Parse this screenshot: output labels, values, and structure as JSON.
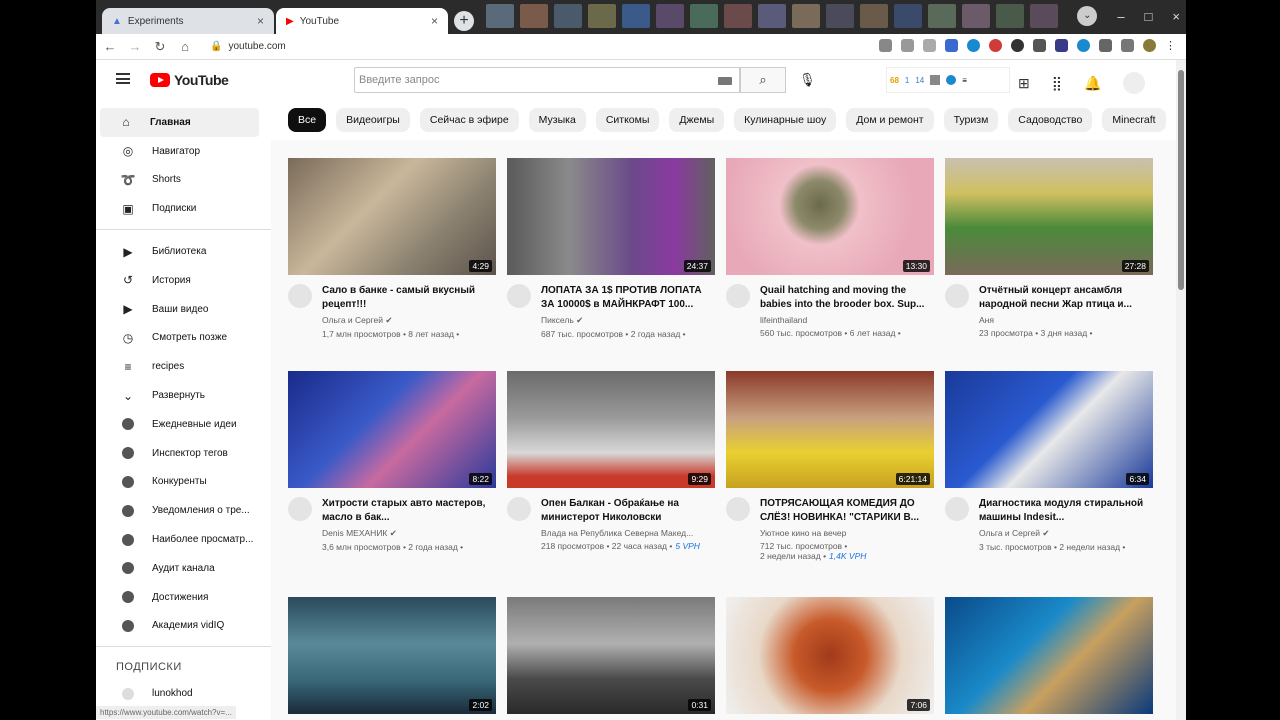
{
  "browser": {
    "tabs": [
      {
        "title": "Experiments",
        "icon_color": "#4a6dd8"
      },
      {
        "title": "YouTube",
        "icon_color": "#ff0000"
      }
    ],
    "url": "youtube.com",
    "status_url": "https://www.youtube.com/watch?v=..."
  },
  "youtube": {
    "logo": "YouTube",
    "search_placeholder": "Введите запрос",
    "vidiq": {
      "v1": "68",
      "v2": "1",
      "v3": "14"
    }
  },
  "sidebar": {
    "items": [
      {
        "label": "Главная",
        "icon": "home-icon",
        "glyph": "⌂"
      },
      {
        "label": "Навигатор",
        "icon": "compass-icon",
        "glyph": "◎"
      },
      {
        "label": "Shorts",
        "icon": "shorts-icon",
        "glyph": "➰"
      },
      {
        "label": "Подписки",
        "icon": "subscriptions-icon",
        "glyph": "▣"
      }
    ],
    "items2": [
      {
        "label": "Библиотека",
        "icon": "library-icon",
        "glyph": "▶"
      },
      {
        "label": "История",
        "icon": "history-icon",
        "glyph": "↺"
      },
      {
        "label": "Ваши видео",
        "icon": "your-videos-icon",
        "glyph": "▶"
      },
      {
        "label": "Смотреть позже",
        "icon": "watch-later-icon",
        "glyph": "◷"
      },
      {
        "label": "recipes",
        "icon": "playlist-icon",
        "glyph": "≡"
      },
      {
        "label": "Развернуть",
        "icon": "chevron-down-icon",
        "glyph": "⌄"
      }
    ],
    "vidiq_items": [
      "Ежедневные идеи",
      "Инспектор тегов",
      "Конкуренты",
      "Уведомления о тре...",
      "Наиболее просматр...",
      "Аудит канала",
      "Достижения",
      "Академия vidIQ"
    ],
    "subs_header": "ПОДПИСКИ",
    "subs": [
      "lunokhod"
    ]
  },
  "chips": [
    "Все",
    "Видеоигры",
    "Сейчас в эфире",
    "Музыка",
    "Ситкомы",
    "Джемы",
    "Кулинарные шоу",
    "Дом и ремонт",
    "Туризм",
    "Садоводство",
    "Minecraft",
    "Ре"
  ],
  "videos": [
    {
      "title": "Сало в банке - самый вкусный рецепт!!!",
      "channel": "Ольга и Сергей ✔",
      "stats": "1,7 млн просмотров • 8 лет назад •",
      "duration": "4:29",
      "bg": "linear-gradient(135deg,#7a6a5a,#c9b79a 40%,#8b8170 70%,#5c544c)"
    },
    {
      "title": "ЛОПАТА ЗА 1$ ПРОТИВ ЛОПАТА ЗА 10000$ в МАЙНКРАФТ 100...",
      "channel": "Пиксель ✔",
      "stats": "687 тыс. просмотров • 2 года назад •",
      "duration": "24:37",
      "bg": "linear-gradient(90deg,#5a5a5a,#8a8a8a 30%,#6b4a8a 60%,#8a3aa0 80%,#606060)"
    },
    {
      "title": "Quail hatching and moving the babies into the brooder box. Sup...",
      "channel": "lifeinthailand",
      "stats": "560 тыс. просмотров • 6 лет назад •",
      "duration": "13:30",
      "bg": "radial-gradient(circle at 45% 40%,#6b6a4a 0,#8c8a6a 18%,#f0c0c8 30%,#e8a8b8 70%)"
    },
    {
      "title": "Отчётный концерт ансамбля народной песни Жар птица и...",
      "channel": "Аня",
      "stats": "23 просмотра • 3 дня назад •",
      "duration": "27:28",
      "bg": "linear-gradient(180deg,#c8c0b0,#d0c060 30%,#4a8a3a 60%,#7a6a5a)"
    },
    {
      "title": "Хитрости старых авто мастеров, масло в бак...",
      "channel": "Denis МЕХАНИК ✔",
      "stats": "3,6 млн просмотров • 2 года назад •",
      "duration": "8:22",
      "bg": "linear-gradient(135deg,#1a2a8a,#3a5ac8 40%,#c86aa0 60%,#2a3a9a)"
    },
    {
      "title": "Опен Балкан - Обраќање на министерот Николовски",
      "channel": "Влада на Република Северна Макед...",
      "stats": "218 просмотров • 22 часа назад •",
      "vph": "5 VPH",
      "duration": "9:29",
      "bg": "linear-gradient(180deg,#6a6a6a,#9a9a9a 40%,#d8d8d8 70%,#c83a2a 90%)"
    },
    {
      "title": "ПОТРЯСАЮЩАЯ КОМЕДИЯ ДО СЛЁЗ! НОВИНКА! \"СТАРИКИ В...",
      "channel": "Уютное кино на вечер",
      "stats": "712 тыс. просмотров •",
      "stats2": "2 недели назад •",
      "vph": "1,4K VPH",
      "duration": "6:21:14",
      "bg": "linear-gradient(180deg,#8a3a2a,#c8a080 40%,#e8d030 70%,#c8a020)"
    },
    {
      "title": "Диагностика модуля стиральной машины Indesit...",
      "channel": "Ольга и Сергей ✔",
      "stats": "3 тыс. просмотров • 2 недели назад •",
      "duration": "6:34",
      "bg": "linear-gradient(135deg,#1a3a9a,#2a5ad0 40%,#e8e8e8 55%,#1a3a9a)"
    },
    {
      "title": "",
      "channel": "",
      "stats": "",
      "duration": "2:02",
      "bg": "linear-gradient(180deg,#2a4a5a,#5a8a9a 40%,#3a6a7a 70%,#1a2a3a)"
    },
    {
      "title": "",
      "channel": "",
      "stats": "",
      "duration": "0:31",
      "bg": "linear-gradient(180deg,#7a7a7a,#b0b0b0 40%,#4a4a4a 70%,#2a2a2a)"
    },
    {
      "title": "",
      "channel": "",
      "stats": "",
      "duration": "7:06",
      "bg": "radial-gradient(circle at 50% 50%,#a03a1a 0,#c85a2a 30%,#e8d8c8 60%,#f0f0f0)"
    },
    {
      "title": "",
      "channel": "",
      "stats": "",
      "duration": "",
      "bg": "linear-gradient(135deg,#0a4a8a,#1a8ac8 40%,#c8a060 60%,#0a3a7a)"
    }
  ]
}
